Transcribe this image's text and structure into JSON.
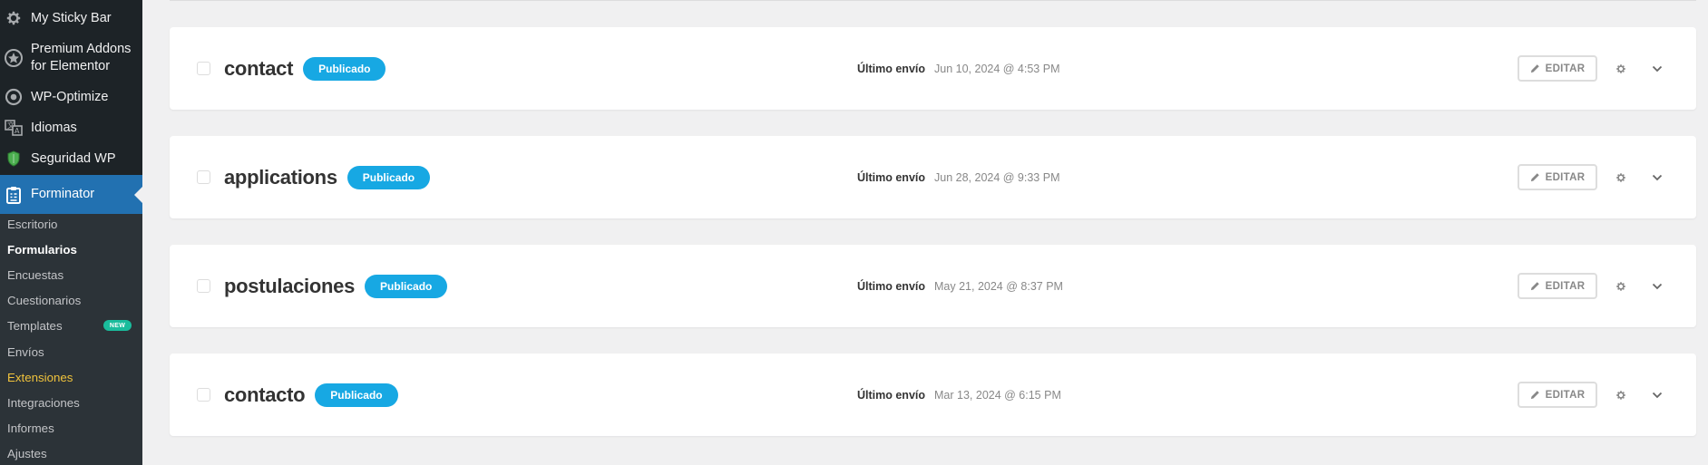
{
  "sidebar": {
    "menu": [
      {
        "label": "My Sticky Bar",
        "icon": "gear-icon"
      },
      {
        "label": "Premium Addons for Elementor",
        "icon": "premium-addons-icon"
      },
      {
        "label": "WP-Optimize",
        "icon": "wp-optimize-icon"
      },
      {
        "label": "Idiomas",
        "icon": "translate-icon"
      },
      {
        "label": "Seguridad WP",
        "icon": "shield-icon"
      },
      {
        "label": "Forminator",
        "icon": "clipboard-icon"
      }
    ],
    "submenu": [
      {
        "label": "Escritorio"
      },
      {
        "label": "Formularios"
      },
      {
        "label": "Encuestas"
      },
      {
        "label": "Cuestionarios"
      },
      {
        "label": "Templates"
      },
      {
        "label": "Envíos"
      },
      {
        "label": "Extensiones"
      },
      {
        "label": "Integraciones"
      },
      {
        "label": "Informes"
      },
      {
        "label": "Ajustes"
      }
    ],
    "new_badge": "NEW"
  },
  "forms": [
    {
      "title": "contact",
      "status": "Publicado",
      "last_label": "Último envío",
      "last_date": "Jun 10, 2024 @ 4:53 PM",
      "edit_label": "EDITAR"
    },
    {
      "title": "applications",
      "status": "Publicado",
      "last_label": "Último envío",
      "last_date": "Jun 28, 2024 @ 9:33 PM",
      "edit_label": "EDITAR"
    },
    {
      "title": "postulaciones",
      "status": "Publicado",
      "last_label": "Último envío",
      "last_date": "May 21, 2024 @ 8:37 PM",
      "edit_label": "EDITAR"
    },
    {
      "title": "contacto",
      "status": "Publicado",
      "last_label": "Último envío",
      "last_date": "Mar 13, 2024 @ 6:15 PM",
      "edit_label": "EDITAR"
    }
  ],
  "colors": {
    "sidebar_bg": "#1d2327",
    "submenu_bg": "#2c3338",
    "current_menu": "#2271b1",
    "status_badge": "#17a8e3",
    "new_badge": "#1abc9c",
    "highlight_text": "#f0c33c"
  }
}
